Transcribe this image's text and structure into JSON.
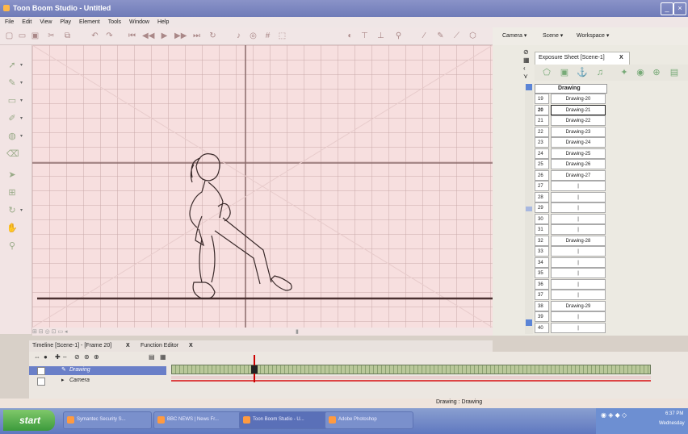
{
  "window": {
    "title": "Toon Boom Studio - Untitled"
  },
  "menu": [
    "File",
    "Edit",
    "View",
    "Play",
    "Element",
    "Tools",
    "Window",
    "Help"
  ],
  "toolbar_right": {
    "camera": "Camera",
    "scene": "Scene",
    "workspace": "Workspace"
  },
  "exposure_sheet": {
    "tab_label": "Exposure Sheet [Scene-1]",
    "close": "X",
    "column_header": "Drawing",
    "current_frame": 20,
    "rows": [
      {
        "frame": "19",
        "cell": "Drawing-20"
      },
      {
        "frame": "20",
        "cell": "Drawing-21"
      },
      {
        "frame": "21",
        "cell": "Drawing-22"
      },
      {
        "frame": "22",
        "cell": "Drawing-23"
      },
      {
        "frame": "23",
        "cell": "Drawing-24"
      },
      {
        "frame": "24",
        "cell": "Drawing-25"
      },
      {
        "frame": "25",
        "cell": "Drawing-26"
      },
      {
        "frame": "26",
        "cell": "Drawing-27"
      },
      {
        "frame": "27",
        "cell": "|"
      },
      {
        "frame": "28",
        "cell": "|"
      },
      {
        "frame": "29",
        "cell": "|"
      },
      {
        "frame": "30",
        "cell": "|"
      },
      {
        "frame": "31",
        "cell": "|"
      },
      {
        "frame": "32",
        "cell": "Drawing-28"
      },
      {
        "frame": "33",
        "cell": "|"
      },
      {
        "frame": "34",
        "cell": "|"
      },
      {
        "frame": "35",
        "cell": "|"
      },
      {
        "frame": "36",
        "cell": "|"
      },
      {
        "frame": "37",
        "cell": "|"
      },
      {
        "frame": "38",
        "cell": "Drawing-29"
      },
      {
        "frame": "39",
        "cell": "|"
      },
      {
        "frame": "40",
        "cell": "|"
      }
    ]
  },
  "timeline": {
    "tab_label": "Timeline [Scene-1] - [Frame 20]",
    "tab_close": "X",
    "function_editor_label": "Function Editor",
    "function_editor_close": "X",
    "layers": [
      {
        "name": "Drawing",
        "selected": true
      },
      {
        "name": "Camera",
        "selected": false
      }
    ]
  },
  "status": {
    "text": "Drawing : Drawing"
  },
  "taskbar": {
    "start": "start",
    "tasks": [
      "Symantec Security S...",
      "BBC NEWS | News Fr...",
      "Toon Boom Studio - U...",
      "Adobe Photoshop"
    ],
    "clock": "6:37 PM",
    "day": "Wednesday"
  },
  "colors": {
    "accent": "#6f7bb8",
    "playhead": "#cc0000",
    "timeline_frames": "#b9c89a"
  }
}
